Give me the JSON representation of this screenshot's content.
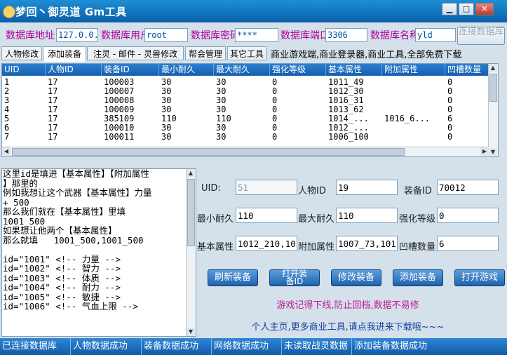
{
  "window": {
    "title": "梦回丶御灵道 Gm工具",
    "minimize": "▁",
    "maximize": "□",
    "close": "✕"
  },
  "db": {
    "host_label": "数据库地址",
    "host_value": "127.0.0.1",
    "user_label": "数据库用户",
    "user_value": "root",
    "pass_label": "数据库密码",
    "pass_value": "****",
    "port_label": "数据库端口",
    "port_value": "3306",
    "name_label": "数据库名称",
    "name_value": "yld",
    "connect_label": "连接数据库"
  },
  "tabs": [
    {
      "label": "人物修改"
    },
    {
      "label": "添加装备"
    },
    {
      "label": "注灵 - 邮件 - 灵兽修改"
    },
    {
      "label": "帮会管理"
    },
    {
      "label": "其它工具"
    }
  ],
  "marquee": "商业游戏端,商业登录器,商业工具,全部免费下载",
  "table": {
    "columns": [
      "UID",
      "人物ID",
      "装备ID",
      "最小耐久",
      "最大耐久",
      "强化等级",
      "基本属性",
      "附加属性",
      "凹槽数量"
    ],
    "rows": [
      [
        "1",
        "17",
        "100003",
        "30",
        "30",
        "0",
        "1011_49",
        "",
        "0"
      ],
      [
        "2",
        "17",
        "100007",
        "30",
        "30",
        "0",
        "1012_30",
        "",
        "0"
      ],
      [
        "3",
        "17",
        "100008",
        "30",
        "30",
        "0",
        "1016_31",
        "",
        "0"
      ],
      [
        "4",
        "17",
        "100009",
        "30",
        "30",
        "0",
        "1013_62",
        "",
        "0"
      ],
      [
        "5",
        "17",
        "385109",
        "110",
        "110",
        "0",
        "1014_...",
        "1016_6...",
        "6"
      ],
      [
        "6",
        "17",
        "100010",
        "30",
        "30",
        "0",
        "1012_...",
        "",
        "0"
      ],
      [
        "7",
        "17",
        "100011",
        "30",
        "30",
        "0",
        "1006_100",
        "",
        "0"
      ]
    ]
  },
  "notes": "这里id是填进【基本属性】【附加属性\n】那里的\n例如我想让这个武器【基本属性】力量\n+ 500\n那么我们就在【基本属性】里填\n1001_500\n如果想让他两个【基本属性】\n那么就填   1001_500,1001_500\n\nid=\"1001\" <!-- 力量 -->\nid=\"1002\" <!-- 智力 -->\nid=\"1003\" <!-- 体质 -->\nid=\"1004\" <!-- 耐力 -->\nid=\"1005\" <!-- 敏捷 -->\nid=\"1006\" <!-- 气血上限 -->",
  "form": {
    "uid_label": "UID:",
    "uid_value": "51",
    "char_label": "人物ID",
    "char_value": "19",
    "equip_label": "装备ID",
    "equip_value": "70012",
    "min_label": "最小耐久",
    "min_value": "110",
    "max_label": "最大耐久",
    "max_value": "110",
    "enh_label": "强化等级",
    "enh_value": "0",
    "base_label": "基本属性",
    "base_value": "1012_210,1011_...",
    "add_label": "附加属性",
    "add_value": "1007_73,1011_...",
    "slot_label": "凹槽数量",
    "slot_value": "6"
  },
  "actions": {
    "refresh": "刷新装备",
    "open_id": "打开装备ID",
    "modify": "修改装备",
    "add": "添加装备",
    "open_game": "打开游戏"
  },
  "tips": {
    "warn": "游戏记得下线,防止回档,数据不易修",
    "home": "个人主页,更多商业工具,请点我进来下载哦~~~"
  },
  "status": [
    "已连接数据库",
    "人物数据成功",
    "装备数据成功",
    "网络数据成功",
    "未读取战灵数据",
    "添加装备数据成功"
  ],
  "colors": {
    "accent": "#1a6fc0",
    "label_magenta": "#b3009a",
    "tip_magenta": "#c0189a",
    "tip_blue": "#1a3fa0"
  }
}
